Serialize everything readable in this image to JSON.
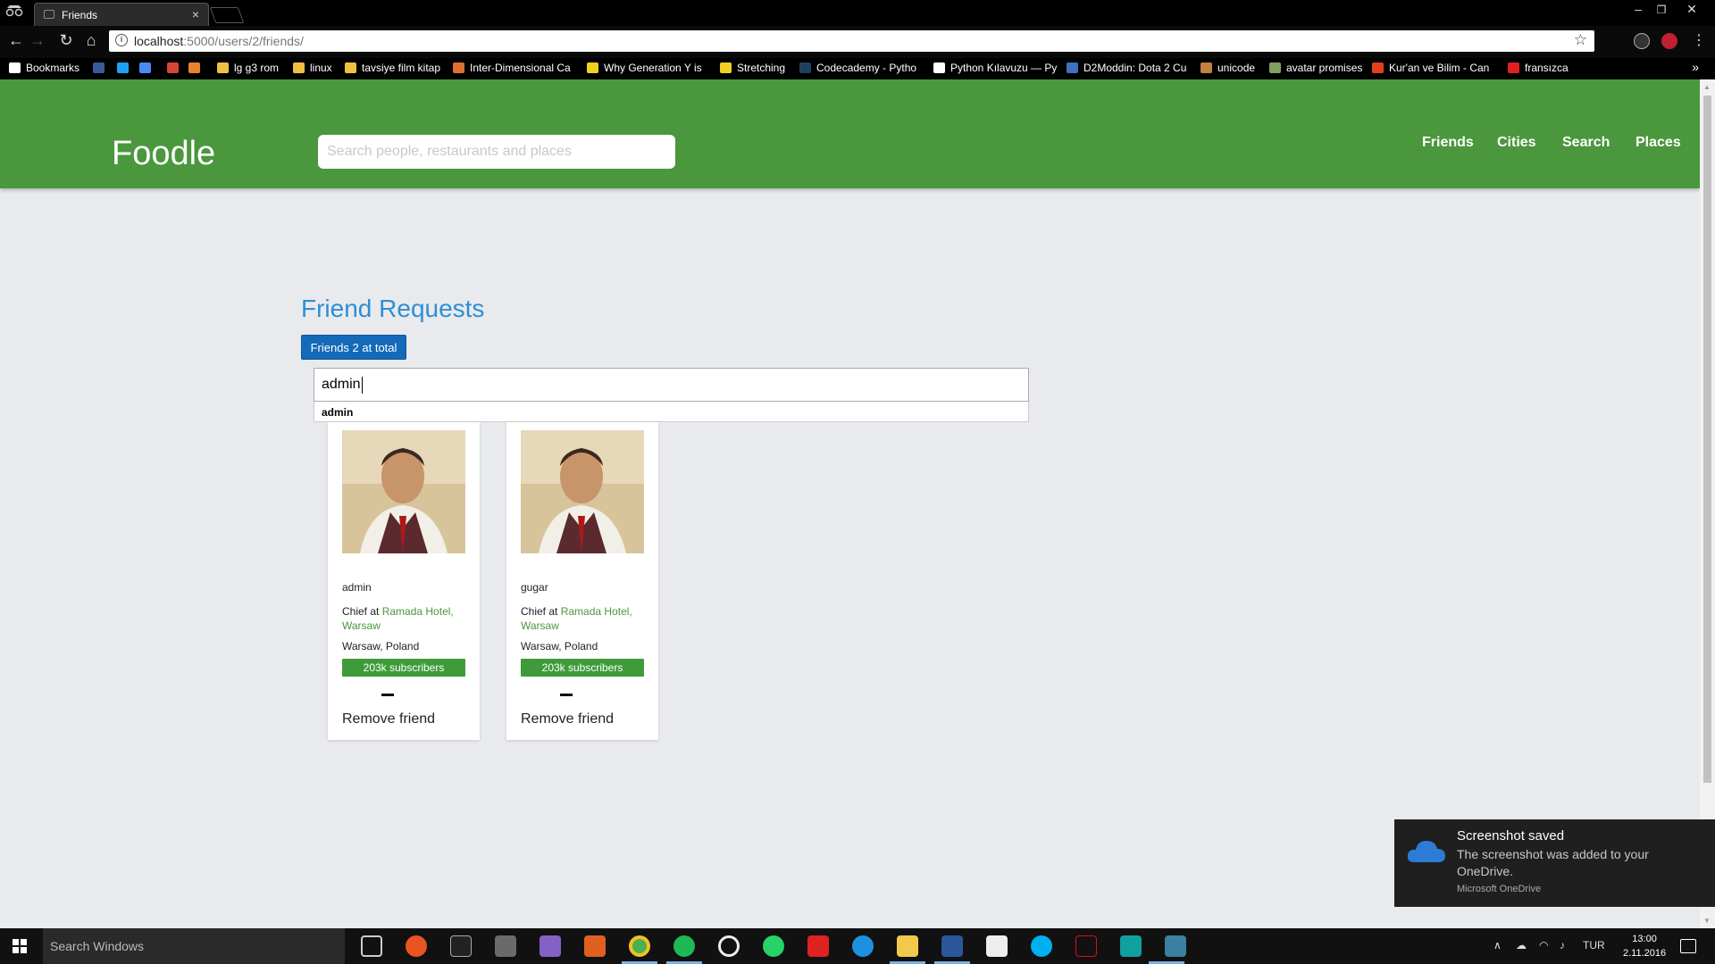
{
  "browser": {
    "tab_title": "Friends",
    "tab_close": "×",
    "url_host": "localhost",
    "url_rest": ":5000/users/2/friends/",
    "info_glyph": "i",
    "star_glyph": "☆",
    "bookmarks": [
      {
        "label": "Bookmarks",
        "color": "#ffffff"
      },
      {
        "label": "",
        "color": "#3b5998"
      },
      {
        "label": "",
        "color": "#1da1f2"
      },
      {
        "label": "",
        "color": "#4a8af4"
      },
      {
        "label": "",
        "color": "#d44638"
      },
      {
        "label": "",
        "color": "#e8822b"
      },
      {
        "label": "lg g3 rom",
        "color": "#f0c040"
      },
      {
        "label": "linux",
        "color": "#f0c040"
      },
      {
        "label": "tavsiye film kitap",
        "color": "#f0c040"
      },
      {
        "label": "Inter-Dimensional Ca",
        "color": "#e07030"
      },
      {
        "label": "Why Generation Y is",
        "color": "#f0d020"
      },
      {
        "label": "Stretching",
        "color": "#f0d020"
      },
      {
        "label": "Codecademy - Pytho",
        "color": "#204060"
      },
      {
        "label": "Python Kılavuzu — Py",
        "color": "#ffffff"
      },
      {
        "label": "D2Moddin: Dota 2 Cu",
        "color": "#4070c0"
      },
      {
        "label": "unicode",
        "color": "#c08040"
      },
      {
        "label": "avatar promises",
        "color": "#80a060"
      },
      {
        "label": "Kur'an ve Bilim - Can",
        "color": "#e04020"
      },
      {
        "label": "fransızca",
        "color": "#e02020"
      }
    ],
    "more_glyph": "»"
  },
  "navbar": {
    "brand": "Foodle",
    "search_placeholder": "Search people, restaurants and places",
    "links": [
      "Friends",
      "Cities",
      "Search",
      "Places"
    ]
  },
  "main": {
    "title": "Friend Requests",
    "badge": "Friends 2 at total",
    "input_value": "admin",
    "suggestion": "admin",
    "cards": [
      {
        "name": "admin",
        "role_prefix": "Chief at ",
        "role_link": "Ramada Hotel, Warsaw",
        "location": "Warsaw, Poland",
        "subscribers": "203k subscribers",
        "action": "Remove friend"
      },
      {
        "name": "gugar",
        "role_prefix": "Chief at ",
        "role_link": "Ramada Hotel, Warsaw",
        "location": "Warsaw, Poland",
        "subscribers": "203k subscribers",
        "action": "Remove friend"
      }
    ]
  },
  "toast": {
    "title": "Screenshot saved",
    "body": "The screenshot was added to your OneDrive.",
    "app": "Microsoft OneDrive"
  },
  "taskbar": {
    "search_placeholder": "Search Windows",
    "language": "TUR",
    "time": "13:00",
    "date": "2.11.2016"
  },
  "colors": {
    "navbar": "#4a973d",
    "title": "#2c8fd6",
    "badge": "#1469b8",
    "subs": "#3f9b3a"
  }
}
